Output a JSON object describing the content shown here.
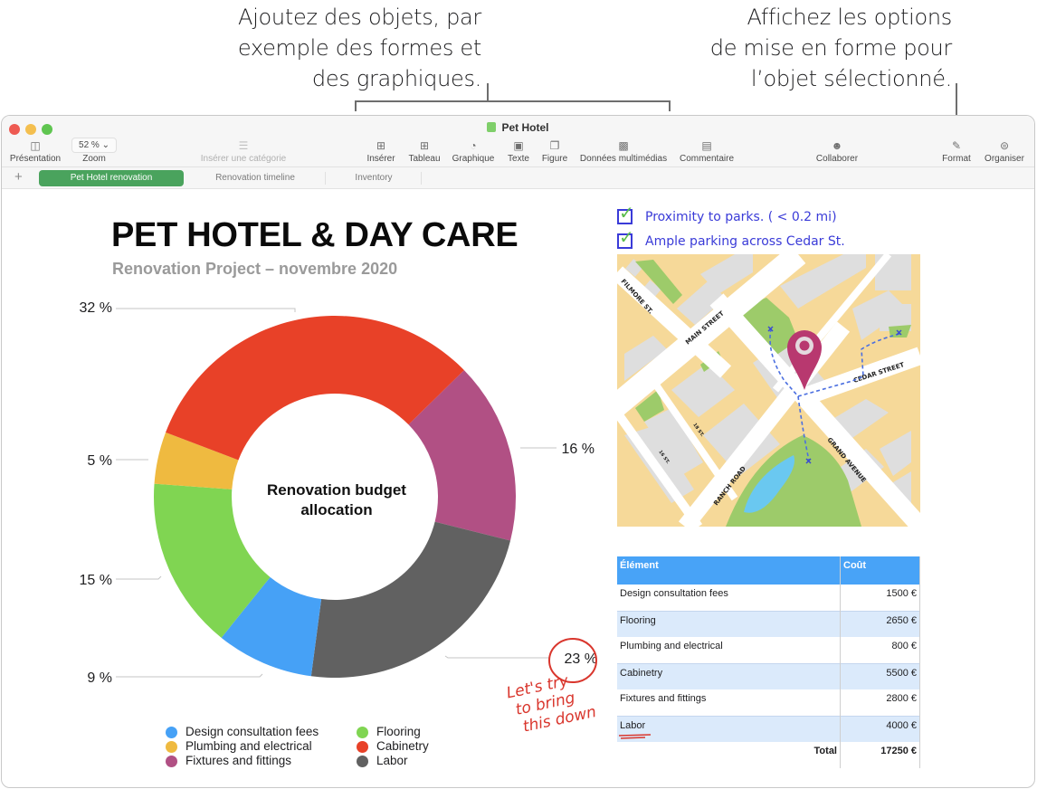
{
  "callouts": {
    "insert": [
      "Ajoutez des objets, par",
      "exemple des formes et",
      "des graphiques."
    ],
    "format": [
      "Affichez les options",
      "de mise en forme pour",
      "l’objet sélectionné."
    ]
  },
  "window": {
    "title": "Pet Hotel",
    "traffic_colors": [
      "#ee5a52",
      "#f4bf4f",
      "#5fc550"
    ]
  },
  "toolbar": {
    "presentation": "Présentation",
    "zoom_value": "52 %",
    "zoom_label": "Zoom",
    "insert_category": "Insérer une catégorie",
    "insert": "Insérer",
    "table": "Tableau",
    "chart": "Graphique",
    "text": "Texte",
    "shape": "Figure",
    "media": "Données multimédias",
    "comment": "Commentaire",
    "collaborate": "Collaborer",
    "format": "Format",
    "organize": "Organiser"
  },
  "tabs": [
    {
      "label": "Pet Hotel renovation",
      "active": true
    },
    {
      "label": "Renovation timeline",
      "active": false
    },
    {
      "label": "Inventory",
      "active": false
    }
  ],
  "document": {
    "title": "PET HOTEL & DAY CARE",
    "subtitle": "Renovation Project – novembre 2020"
  },
  "chart_data": {
    "type": "pie",
    "variant": "donut",
    "title": "Renovation budget allocation",
    "categories": [
      "Design consultation fees",
      "Flooring",
      "Plumbing and electrical",
      "Cabinetry",
      "Fixtures and fittings",
      "Labor"
    ],
    "values": [
      1500,
      2650,
      800,
      5500,
      2800,
      4000
    ],
    "percent_labels": [
      "9 %",
      "15 %",
      "5 %",
      "32 %",
      "16 %",
      "23 %"
    ],
    "colors": [
      "#46a1f6",
      "#80d552",
      "#efba40",
      "#e84128",
      "#b15084",
      "#616161"
    ],
    "legend_position": "bottom",
    "start_category": "Fixtures and fittings",
    "start_angle_deg": 45.6,
    "slice_order_clockwise": [
      "Fixtures and fittings",
      "Labor",
      "Design consultation fees",
      "Flooring",
      "Plumbing and electrical",
      "Cabinetry"
    ]
  },
  "legend": {
    "left": [
      "Design consultation fees",
      "Plumbing and electrical",
      "Fixtures and fittings"
    ],
    "left_colors": [
      "#46a1f6",
      "#efba40",
      "#b15084"
    ],
    "right": [
      "Flooring",
      "Cabinetry",
      "Labor"
    ],
    "right_colors": [
      "#80d552",
      "#e84128",
      "#616161"
    ]
  },
  "annotation": {
    "note_lines": [
      "Let's try",
      "to bring",
      "this down"
    ],
    "ink_color": "#d9362d"
  },
  "checklist": [
    {
      "label": "Proximity to parks. ( < 0.2 mi)",
      "checked": true
    },
    {
      "label": "Ample parking across  Cedar St.",
      "checked": true
    }
  ],
  "map": {
    "streets": [
      "FILMORE ST.",
      "MAIN STREET",
      "CEDAR STREET",
      "GRAND AVENUE",
      "RANCH ROAD",
      "18 ST.",
      "16 ST."
    ],
    "pin_color": "#b8386f"
  },
  "table": {
    "headers": [
      "Élément",
      "Coût"
    ],
    "rows": [
      [
        "Design consultation fees",
        "1500 €"
      ],
      [
        "Flooring",
        "2650 €"
      ],
      [
        "Plumbing and electrical",
        "800 €"
      ],
      [
        "Cabinetry",
        "5500 €"
      ],
      [
        "Fixtures and fittings",
        "2800 €"
      ],
      [
        "Labor",
        "4000 €"
      ]
    ],
    "total_label": "Total",
    "total_value": "17250 €"
  }
}
